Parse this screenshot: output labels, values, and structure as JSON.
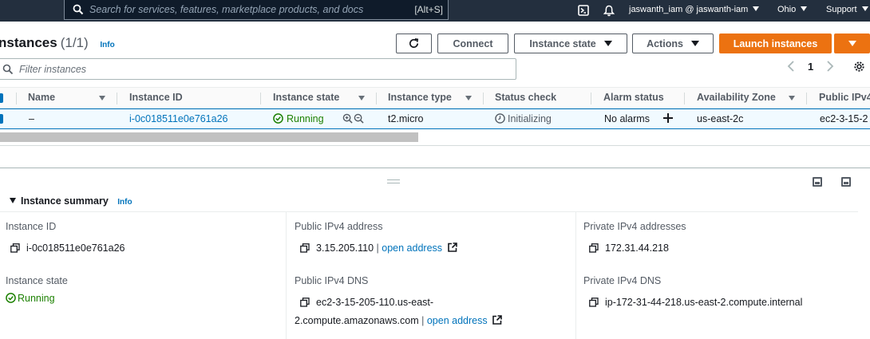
{
  "topnav": {
    "search_placeholder": "Search for services, features, marketplace products, and docs",
    "search_shortcut": "[Alt+S]",
    "user": "jaswanth_iam @ jaswanth-iam",
    "region": "Ohio",
    "support": "Support",
    "icons": [
      "cloudshell-icon",
      "bell-icon",
      "search-icon"
    ]
  },
  "header": {
    "title": "nstances",
    "count": "(1/1)",
    "info": "Info",
    "buttons": {
      "connect": "Connect",
      "instance_state": "Instance state",
      "actions": "Actions",
      "launch": "Launch instances"
    }
  },
  "filter": {
    "placeholder": "Filter instances",
    "page": "1"
  },
  "table": {
    "columns": [
      "Name",
      "Instance ID",
      "Instance state",
      "Instance type",
      "Status check",
      "Alarm status",
      "Availability Zone",
      "Public IPv4"
    ],
    "rows": [
      {
        "name": "–",
        "instance_id": "i-0c018511e0e761a26",
        "state": "Running",
        "type": "t2.micro",
        "status_check": "Initializing",
        "alarm_status": "No alarms",
        "az": "us-east-2c",
        "public_dns": "ec2-3-15-2"
      }
    ]
  },
  "summary": {
    "title": "Instance summary",
    "info": "Info",
    "instance_id_label": "Instance ID",
    "instance_id": "i-0c018511e0e761a26",
    "state_label": "Instance state",
    "state": "Running",
    "public_ip_label": "Public IPv4 address",
    "public_ip": "3.15.205.110",
    "open_address": "open address",
    "public_dns_label": "Public IPv4 DNS",
    "public_dns_line1": "ec2-3-15-205-110.us-east-",
    "public_dns_line2": "2.compute.amazonaws.com",
    "private_ip_label": "Private IPv4 addresses",
    "private_ip": "172.31.44.218",
    "private_dns_label": "Private IPv4 DNS",
    "private_dns": "ip-172-31-44-218.us-east-2.compute.internal"
  },
  "colors": {
    "nav_bg": "#232f3e",
    "primary": "#ec7211",
    "link": "#0073bb",
    "success": "#1d8102",
    "selected_row": "#f1faff"
  }
}
